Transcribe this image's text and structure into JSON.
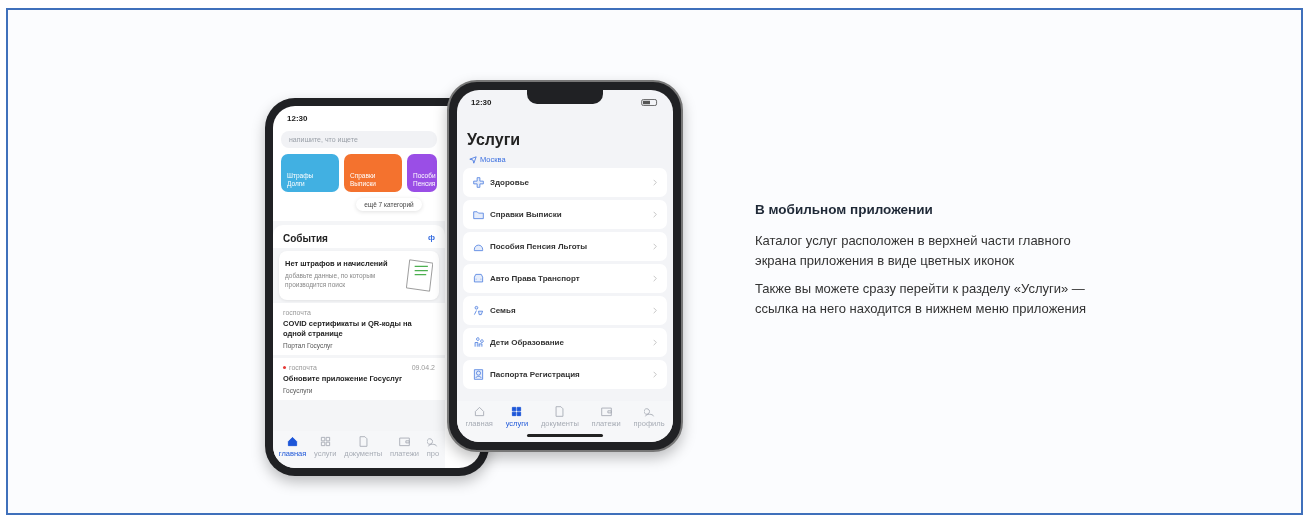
{
  "back_phone": {
    "time": "12:30",
    "search": {
      "placeholder": "напишите, что ищете"
    },
    "categories": [
      {
        "lines": [
          "Штрафы",
          "Долги"
        ],
        "color": "#41b0e2"
      },
      {
        "lines": [
          "Справки",
          "Выписки"
        ],
        "color": "#f4722e"
      },
      {
        "lines": [
          "Пособи",
          "Пенсия"
        ],
        "color": "#9a4ee6"
      }
    ],
    "more_button": "ещё 7 категорий",
    "events_title": "События",
    "events_link": "ф",
    "notice": {
      "title": "Нет штрафов и начислений",
      "text": "добавьте данные, по которым производится поиск"
    },
    "feed": [
      {
        "source": "госпочта",
        "unread": false,
        "title": "COVID сертификаты и QR-коды на одной странице",
        "subtitle": "Портал Госуслуг"
      },
      {
        "source": "госпочта",
        "unread": true,
        "date": "09.04.2",
        "title": "Обновите приложение Госуслуг",
        "subtitle": "Госуслуги"
      }
    ],
    "tabs": [
      {
        "label": "главная",
        "selected": true
      },
      {
        "label": "услуги",
        "selected": false
      },
      {
        "label": "документы",
        "selected": false
      },
      {
        "label": "платежи",
        "selected": false
      },
      {
        "label": "про",
        "selected": false
      }
    ]
  },
  "front_phone": {
    "time": "12:30",
    "title": "Услуги",
    "location": "Москва",
    "services": [
      "Здоровье",
      "Справки Выписки",
      "Пособия Пенсия Льготы",
      "Авто Права Транспорт",
      "Семья",
      "Дети Образование",
      "Паспорта Регистрация"
    ],
    "tabs": [
      {
        "label": "главная",
        "selected": false
      },
      {
        "label": "услуги",
        "selected": true
      },
      {
        "label": "документы",
        "selected": false
      },
      {
        "label": "платежи",
        "selected": false
      },
      {
        "label": "профиль",
        "selected": false
      }
    ]
  },
  "info": {
    "heading": "В мобильном приложении",
    "paragraphs": [
      "Каталог услуг расположен в верхней части главного экрана приложения в виде цветных иконок",
      "Также вы можете сразу перейти к разделу «Услуги» — ссылка на него находится в нижнем меню приложения"
    ]
  }
}
